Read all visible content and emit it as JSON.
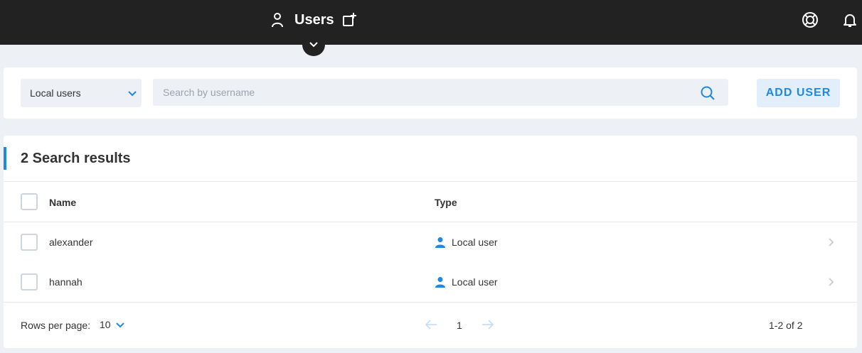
{
  "header": {
    "title": "Users",
    "icons": [
      "user-icon",
      "add-window-icon",
      "help-lifebuoy-icon",
      "bell-icon",
      "chevron-down-icon"
    ]
  },
  "filters": {
    "user_type_selected": "Local users",
    "search_placeholder": "Search by username",
    "search_value": "",
    "add_user_label": "ADD USER"
  },
  "results": {
    "title": "2 Search results",
    "columns": {
      "name": "Name",
      "type": "Type"
    },
    "rows": [
      {
        "name": "alexander",
        "type": "Local user"
      },
      {
        "name": "hannah",
        "type": "Local user"
      }
    ]
  },
  "pagination": {
    "rows_per_page_label": "Rows per page:",
    "rows_per_page_value": "10",
    "current_page": "1",
    "range_text": "1-2 of 2"
  },
  "colors": {
    "topbar": "#222222",
    "accent": "#1e88e5",
    "background": "#edf1f5"
  }
}
